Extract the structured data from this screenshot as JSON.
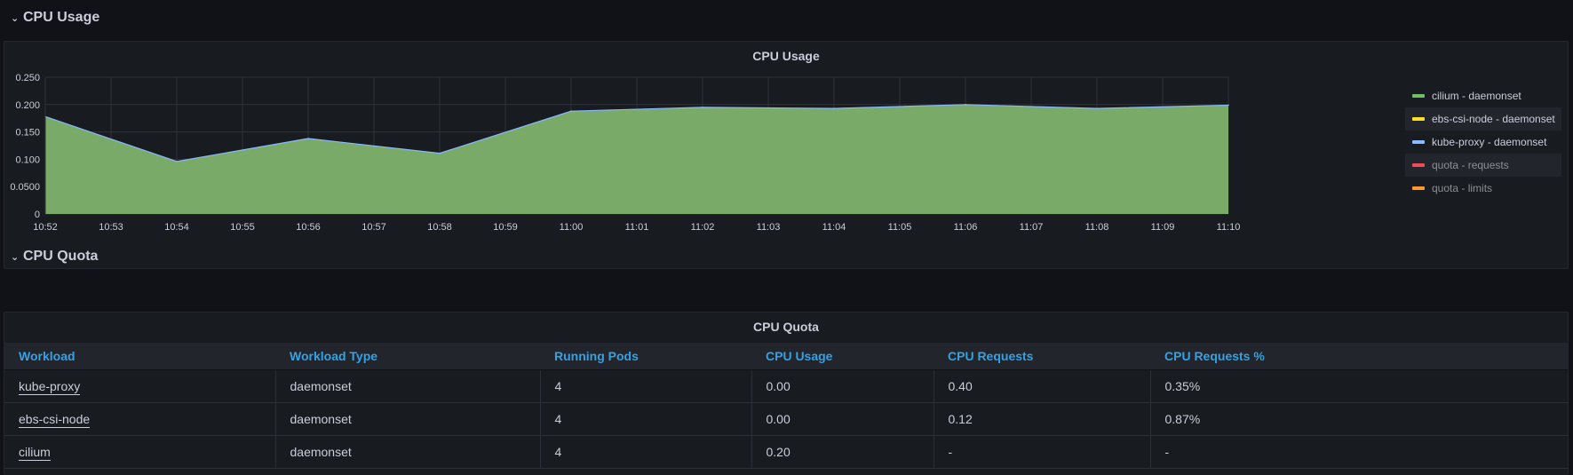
{
  "rows": [
    {
      "title": "CPU Usage"
    },
    {
      "title": "CPU Quota"
    }
  ],
  "usage_panel": {
    "title": "CPU Usage",
    "legend": [
      {
        "name": "cilium - daemonset",
        "color": "#73bf69",
        "hidden": false
      },
      {
        "name": "ebs-csi-node - daemonset",
        "color": "#fade2a",
        "hidden": false
      },
      {
        "name": "kube-proxy - daemonset",
        "color": "#8ab8ff",
        "hidden": false
      },
      {
        "name": "quota - requests",
        "color": "#f2495c",
        "hidden": true
      },
      {
        "name": "quota - limits",
        "color": "#ff9830",
        "hidden": true
      }
    ]
  },
  "chart_data": {
    "type": "area",
    "x": [
      "10:52",
      "10:53",
      "10:54",
      "10:55",
      "10:56",
      "10:57",
      "10:58",
      "10:59",
      "11:00",
      "11:01",
      "11:02",
      "11:03",
      "11:04",
      "11:05",
      "11:06",
      "11:07",
      "11:08",
      "11:09",
      "11:10"
    ],
    "y_ticks": [
      "0",
      "0.0500",
      "0.100",
      "0.150",
      "0.200",
      "0.250"
    ],
    "ylim": [
      0,
      0.25
    ],
    "series": [
      {
        "name": "cilium - daemonset",
        "color": "#73bf69",
        "points": [
          [
            0,
            0.178
          ],
          [
            2,
            0.096
          ],
          [
            4,
            0.138
          ],
          [
            6,
            0.111
          ],
          [
            8,
            0.188
          ],
          [
            10,
            0.195
          ],
          [
            12,
            0.193
          ],
          [
            14,
            0.2
          ],
          [
            16,
            0.193
          ],
          [
            18,
            0.199
          ]
        ]
      }
    ],
    "grid": true,
    "legend": "right"
  },
  "quota_panel": {
    "title": "CPU Quota",
    "columns": [
      "Workload",
      "Workload Type",
      "Running Pods",
      "CPU Usage",
      "CPU Requests",
      "CPU Requests %"
    ],
    "rows": [
      [
        "kube-proxy",
        "daemonset",
        "4",
        "0.00",
        "0.40",
        "0.35%"
      ],
      [
        "ebs-csi-node",
        "daemonset",
        "4",
        "0.00",
        "0.12",
        "0.87%"
      ],
      [
        "cilium",
        "daemonset",
        "4",
        "0.20",
        "-",
        "-"
      ]
    ]
  }
}
